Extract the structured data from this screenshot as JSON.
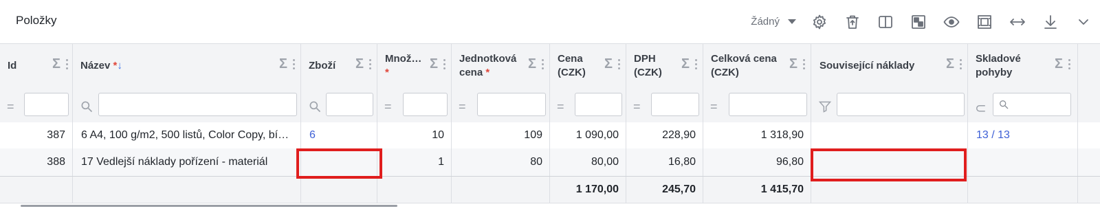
{
  "panel": {
    "title": "Položky"
  },
  "toolbar": {
    "selector_value": "Žádný",
    "icons": [
      "gear-icon",
      "trash-icon",
      "split-view-icon",
      "layout-icon",
      "eye-icon",
      "fit-icon",
      "horizontal-expand-icon",
      "download-icon",
      "chevron-down-icon"
    ]
  },
  "columns": [
    {
      "id": "id",
      "label": "Id",
      "required": false
    },
    {
      "id": "nazev",
      "label": "Název",
      "required": true,
      "sort": "↓"
    },
    {
      "id": "zbozi",
      "label": "Zboží",
      "required": false
    },
    {
      "id": "mnozstvi",
      "label": "Množ…",
      "required": true
    },
    {
      "id": "jednotkova",
      "label_1": "Jednotková",
      "label_2": "cena",
      "required": true
    },
    {
      "id": "cena",
      "label_1": "Cena",
      "label_2": "(CZK)"
    },
    {
      "id": "dph",
      "label_1": "DPH",
      "label_2": "(CZK)"
    },
    {
      "id": "celkova",
      "label_1": "Celková cena",
      "label_2": "(CZK)"
    },
    {
      "id": "souvisejici",
      "label": "Související náklady"
    },
    {
      "id": "skladove",
      "label_1": "Skladové",
      "label_2": "pohyby"
    }
  ],
  "required_mark": "*",
  "sigma": "Σ",
  "rows": [
    {
      "id": "387",
      "nazev": "6 A4, 100 g/m2, 500 listů, Color Copy, bí…",
      "zbozi": "6",
      "mnozstvi": "10",
      "jednotkova": "109",
      "cena": "1 090,00",
      "dph": "228,90",
      "celkova": "1 318,90",
      "souvisejici": "",
      "skladove": "13 / 13"
    },
    {
      "id": "388",
      "nazev": "17 Vedlejší náklady pořízení - materiál",
      "zbozi": "",
      "mnozstvi": "1",
      "jednotkova": "80",
      "cena": "80,00",
      "dph": "16,80",
      "celkova": "96,80",
      "souvisejici": "",
      "skladove": ""
    }
  ],
  "totals": {
    "cena": "1 170,00",
    "dph": "245,70",
    "celkova": "1 415,70"
  },
  "highlight_color": "#e01e1e"
}
